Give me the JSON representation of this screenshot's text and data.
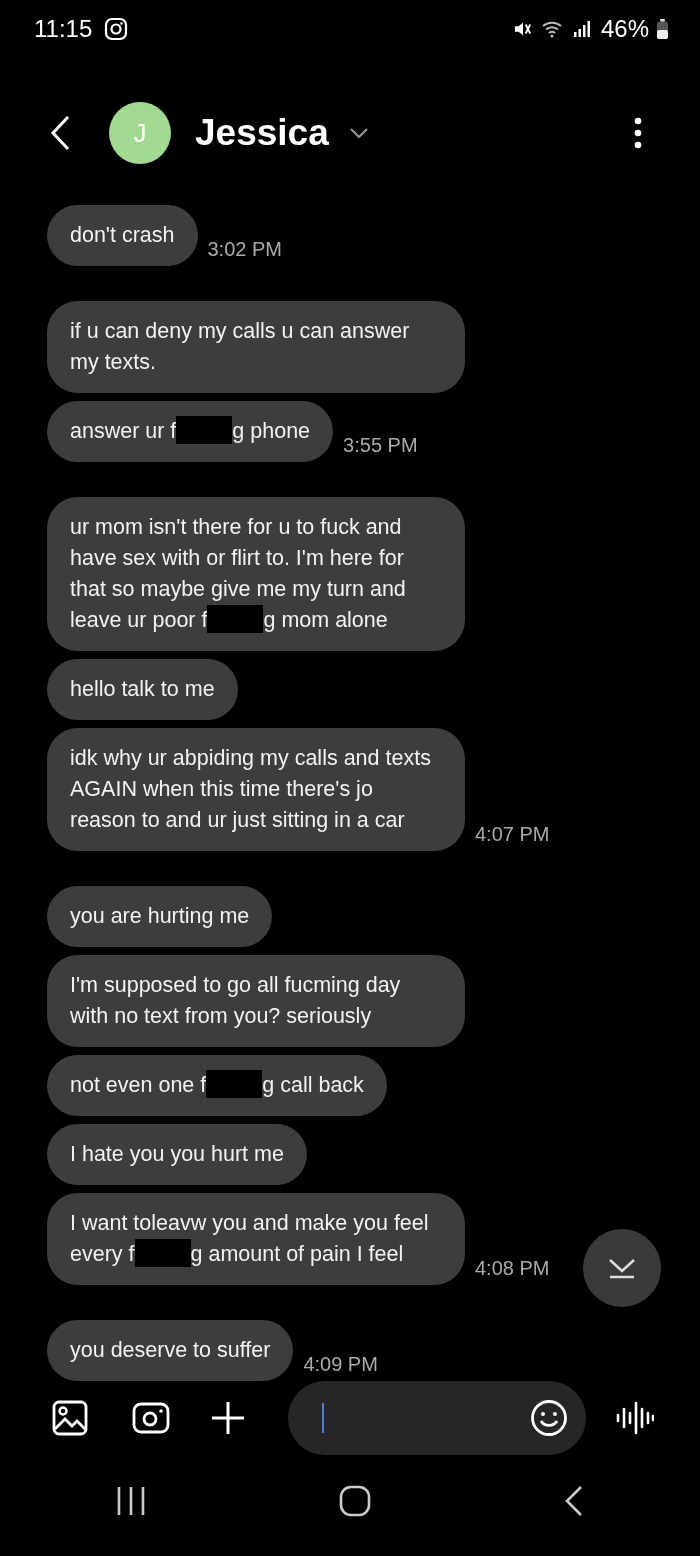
{
  "status_bar": {
    "time": "11:15",
    "battery": "46%"
  },
  "header": {
    "contact_name": "Jessica",
    "avatar_letter": "J"
  },
  "groups": [
    {
      "time": "3:02 PM",
      "messages": [
        {
          "parts": [
            "don't crash"
          ]
        }
      ]
    },
    {
      "time": "3:55 PM",
      "messages": [
        {
          "parts": [
            "if u can deny my calls u can answer my texts."
          ]
        },
        {
          "parts": [
            "answer ur f",
            "g phone"
          ]
        }
      ]
    },
    {
      "time": "4:07 PM",
      "messages": [
        {
          "parts": [
            "ur mom isn't there for u to fuck and have sex with or flirt to. I'm here for that so maybe give me my turn and leave ur poor f",
            "g mom alone"
          ]
        },
        {
          "parts": [
            "hello talk to me"
          ]
        },
        {
          "parts": [
            "idk why ur abpiding my calls and texts AGAIN when this time there's jo reason to and ur just sitting in a car"
          ]
        }
      ]
    },
    {
      "time": "4:08 PM",
      "messages": [
        {
          "parts": [
            "you are hurting me"
          ]
        },
        {
          "parts": [
            "I'm supposed to go all fucming day with no text from you? seriously"
          ]
        },
        {
          "parts": [
            "not even one f",
            "g call back"
          ]
        },
        {
          "parts": [
            "I hate you you hurt me"
          ]
        },
        {
          "parts": [
            "I want toleavw you and make you feel every f",
            "g amount of pain I feel"
          ]
        }
      ]
    },
    {
      "time": "4:09 PM",
      "messages": [
        {
          "parts": [
            "you deserve to suffer"
          ]
        }
      ]
    }
  ]
}
